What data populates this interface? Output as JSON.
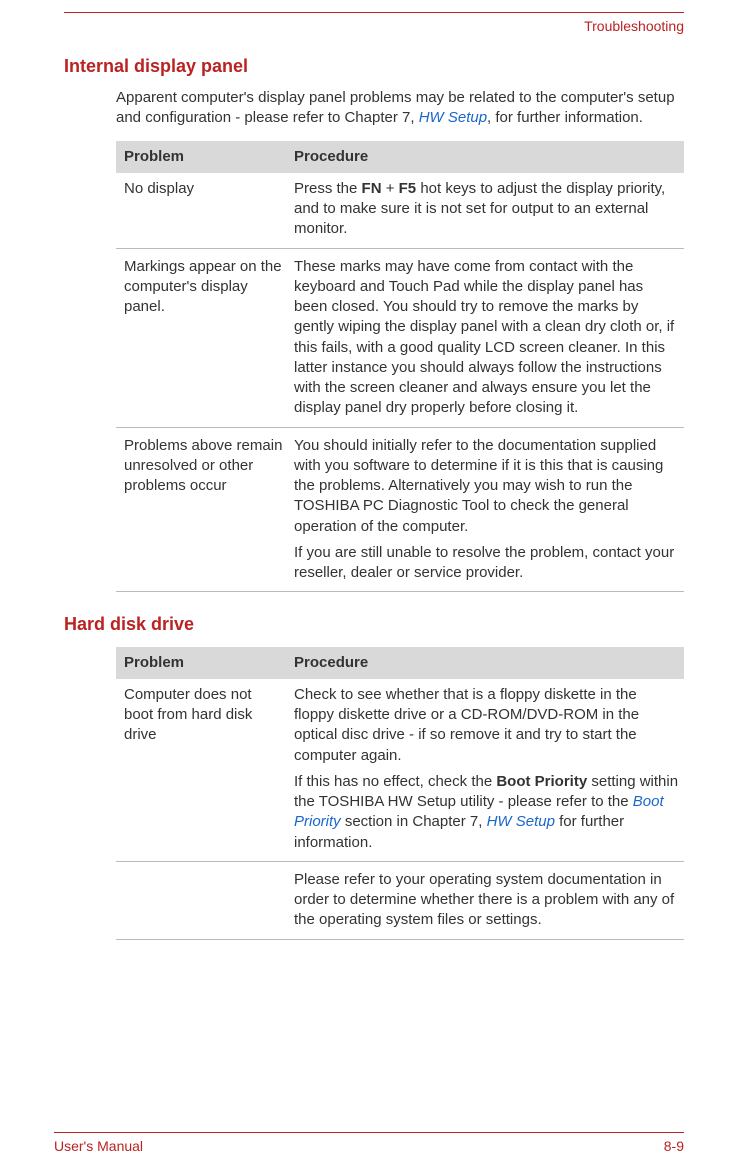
{
  "header": {
    "running_head": "Troubleshooting"
  },
  "section1": {
    "heading": "Internal display panel",
    "intro_a": "Apparent computer's display panel problems may be related to the computer's setup and configuration - please refer to Chapter 7, ",
    "intro_link": "HW Setup",
    "intro_b": ", for further information."
  },
  "table1": {
    "head_problem": "Problem",
    "head_procedure": "Procedure",
    "rows": [
      {
        "problem": "No display",
        "proc_a": "Press the ",
        "proc_b": "FN",
        "proc_c": " + ",
        "proc_d": "F5",
        "proc_e": " hot keys to adjust the display priority, and to make sure it is not set for output to an external monitor."
      },
      {
        "problem": "Markings appear on the computer's display panel.",
        "procedure": "These marks may have come from contact with the keyboard and Touch Pad while the display panel has been closed. You should try to remove the marks by gently wiping the display panel with a clean dry cloth or, if this fails, with a good quality LCD screen cleaner. In this latter instance you should always follow the instructions with the screen cleaner and always ensure you let the display panel dry properly before closing it."
      },
      {
        "problem": "Problems above remain unresolved or other problems occur",
        "procedure": "You should initially refer to the documentation supplied with you software to determine if it is this that is causing the problems. Alternatively you may wish to run the TOSHIBA PC Diagnostic Tool to check the general operation of the computer.",
        "procedure2": "If you are still unable to resolve the problem, contact your reseller, dealer or service provider."
      }
    ]
  },
  "section2": {
    "heading": "Hard disk drive"
  },
  "table2": {
    "head_problem": "Problem",
    "head_procedure": "Procedure",
    "rows": [
      {
        "problem": "Computer does not boot from hard disk drive",
        "proc_a": "Check to see whether that is a floppy diskette in the floppy diskette drive or a CD-ROM/DVD-ROM in the optical disc drive - if so remove it and try to start the computer again.",
        "proc_b1": "If this has no effect, check the ",
        "proc_b2": "Boot Priority",
        "proc_b3": " setting within the TOSHIBA HW Setup utility - please refer to the ",
        "proc_b4": "Boot Priority",
        "proc_b5": " section in Chapter 7, ",
        "proc_b6": "HW Setup",
        "proc_b7": " for further information.",
        "proc_c": "Please refer to your operating system documentation in order to determine whether there is a problem with any of the operating system files or settings."
      }
    ]
  },
  "footer": {
    "left": "User's Manual",
    "right": "8-9"
  }
}
